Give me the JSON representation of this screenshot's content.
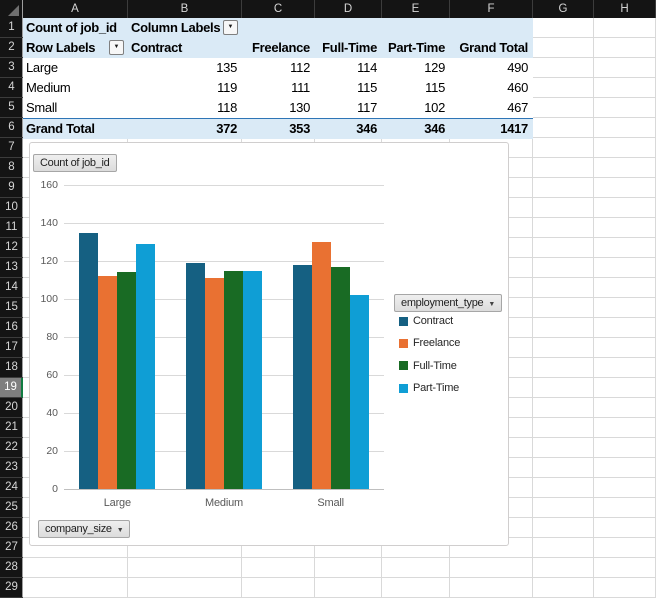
{
  "sheet": {
    "column_headers": [
      "A",
      "B",
      "C",
      "D",
      "E",
      "F",
      "G",
      "H"
    ],
    "row_headers": [
      "1",
      "2",
      "3",
      "4",
      "5",
      "6",
      "7",
      "8",
      "9",
      "10",
      "11",
      "12",
      "13",
      "14",
      "15",
      "16",
      "17",
      "18",
      "19",
      "20",
      "21",
      "22",
      "23",
      "24",
      "25",
      "26",
      "27",
      "28",
      "29"
    ],
    "active_row": "19"
  },
  "pivot_table": {
    "value_field": "Count of job_id",
    "column_labels_header": "Column Labels",
    "row_labels_header": "Row Labels",
    "column_headers": [
      "Contract",
      "Freelance",
      "Full-Time",
      "Part-Time",
      "Grand Total"
    ],
    "rows": [
      {
        "label": "Large",
        "values": [
          "135",
          "112",
          "114",
          "129",
          "490"
        ]
      },
      {
        "label": "Medium",
        "values": [
          "119",
          "111",
          "115",
          "115",
          "460"
        ]
      },
      {
        "label": "Small",
        "values": [
          "118",
          "130",
          "117",
          "102",
          "467"
        ]
      }
    ],
    "grand_total": {
      "label": "Grand Total",
      "values": [
        "372",
        "353",
        "346",
        "346",
        "1417"
      ]
    },
    "fill_color": "#daeaf6",
    "border_color": "#2e75b6"
  },
  "chart_data": {
    "type": "bar",
    "categories": [
      "Large",
      "Medium",
      "Small"
    ],
    "series": [
      {
        "name": "Contract",
        "color": "#156082",
        "values": [
          135,
          119,
          118
        ]
      },
      {
        "name": "Freelance",
        "color": "#E97132",
        "values": [
          112,
          111,
          130
        ]
      },
      {
        "name": "Full-Time",
        "color": "#196B24",
        "values": [
          114,
          115,
          117
        ]
      },
      {
        "name": "Part-Time",
        "color": "#0F9ED5",
        "values": [
          129,
          115,
          102
        ]
      }
    ],
    "ylim": [
      0,
      160
    ],
    "ytick_step": 20,
    "yticks": [
      "0",
      "20",
      "40",
      "60",
      "80",
      "100",
      "120",
      "140",
      "160"
    ],
    "grid": true,
    "legend_position": "right",
    "buttons": {
      "value": "Count of job_id",
      "legend_field": "employment_type",
      "axis_field": "company_size"
    }
  }
}
